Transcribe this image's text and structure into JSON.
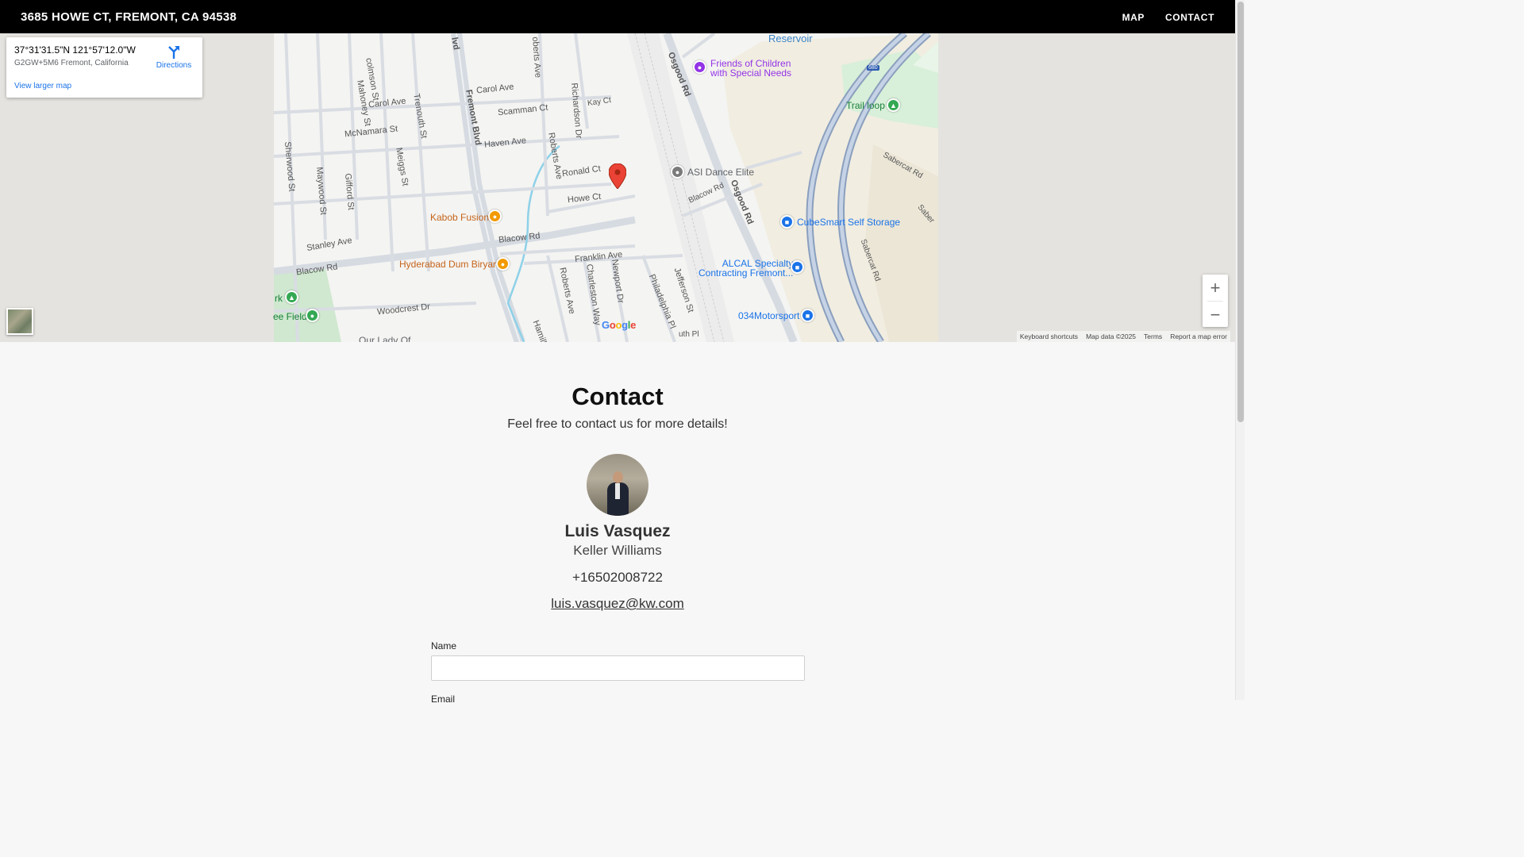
{
  "header": {
    "address": "3685 HOWE CT, FREMONT, CA 94538",
    "nav": [
      "MAP",
      "CONTACT"
    ]
  },
  "map": {
    "info_card": {
      "coords": "37°31'31.5\"N 121°57'12.0\"W",
      "plus_code": "G2GW+5M6 Fremont, California",
      "directions": "Directions",
      "view_larger": "View larger map"
    },
    "streets": {
      "colmson": "colmson St",
      "fremont_blvd": "Fremont Blvd",
      "blvd_top": "lvd",
      "roberts_top": "oberts Ave",
      "carol_ave_1": "Carol Ave",
      "carol_ave_2": "Carol Ave",
      "scamman": "Scamman Ct",
      "richardson": "Richardson Dr",
      "kay": "Kay Ct",
      "mahoney": "Mahoney St",
      "trenouth": "Trenouth St",
      "mcnamara": "McNamara St",
      "haven": "Haven Ave",
      "meiggs": "Meiggs St",
      "sherwood": "Sherwood St",
      "maywood": "Maywood St",
      "gifford": "Gifford St",
      "roberts_mid": "Roberts Ave",
      "ronald": "Ronald Ct",
      "howe": "Howe Ct",
      "osgood_top": "Osgood Rd",
      "osgood_mid": "Osgood Rd",
      "blacow_rd_right": "Blacow Rd",
      "stanley": "Stanley Ave",
      "blacow_rd_mid": "Blacow Rd",
      "blacow_rd_left": "Blacow Rd",
      "franklin": "Franklin Ave",
      "roberts_low": "Roberts Ave",
      "charleston": "Charleston Way",
      "newport": "Newport Dr",
      "philadelphia": "Philadelphia Pl",
      "jefferson": "Jefferson St",
      "woodcrest": "Woodcrest Dr",
      "hamill": "Hamill",
      "sabercat_1": "Sabercat Rd",
      "sabercat_2": "Sabercat Rd",
      "sabercat_3": "Saber",
      "reservoir": "Reservoir",
      "interstate": "680",
      "south_pl": "uth Pl"
    },
    "pois": {
      "friends": "Friends of Children\nwith Special Needs",
      "trail_loop": "Trail loop",
      "asi": "ASI Dance Elite",
      "cubesmart": "CubeSmart Self Storage",
      "kabob": "Kabob Fusion",
      "hyderabad": "Hyderabad Dum Biryani",
      "alcal": "ALCAL Specialty\nContracting Fremont...",
      "motorsport": "034Motorsport",
      "park_left": "rk",
      "field": "ee Field",
      "our_lady": "Our Lady Of"
    },
    "google": [
      "G",
      "o",
      "o",
      "g",
      "l",
      "e"
    ],
    "zoom_in": "+",
    "zoom_out": "−",
    "attribution": [
      "Keyboard shortcuts",
      "Map data ©2025",
      "Terms",
      "Report a map error"
    ]
  },
  "contact": {
    "title": "Contact",
    "subtitle": "Feel free to contact us for more details!",
    "name": "Luis Vasquez",
    "company": "Keller Williams",
    "phone": "+16502008722",
    "email": "luis.vasquez@kw.com",
    "form": {
      "name_label": "Name",
      "name_value": "",
      "email_label": "Email"
    }
  },
  "colors": {
    "header_bg": "#000000",
    "link_blue": "#1a73e8",
    "marker_red": "#ea4335",
    "poi_orange": "#c5641c",
    "poi_blue": "#1a73e8",
    "poi_purple": "#9334e6",
    "poi_green": "#188038"
  }
}
